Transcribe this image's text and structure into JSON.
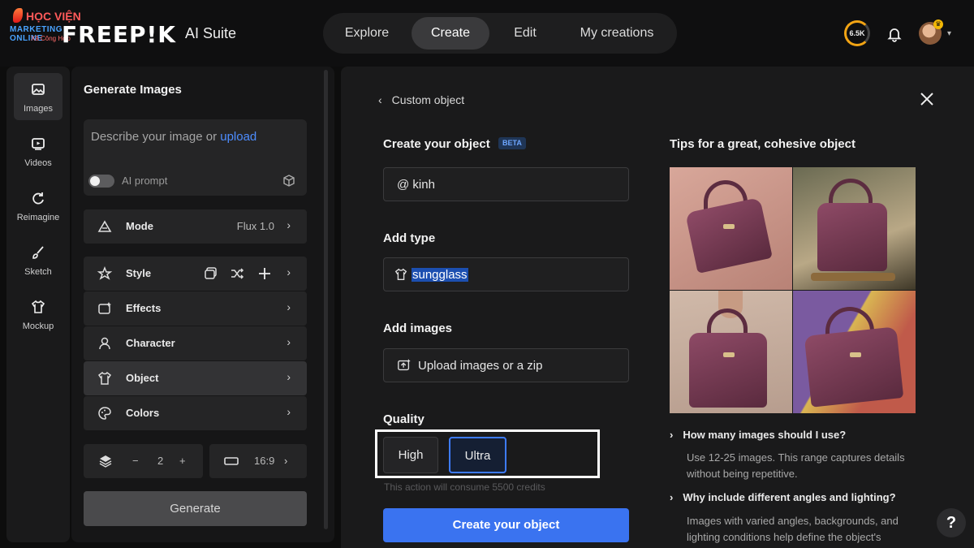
{
  "watermark": {
    "line1": "HỌC VIỆN",
    "line2": "MARKETING ONLINE",
    "line3": "Xã Công Hợp"
  },
  "header": {
    "logo": "FREEP!K",
    "suite": "AI Suite",
    "tabs": [
      {
        "label": "Explore",
        "active": false
      },
      {
        "label": "Create",
        "active": true
      },
      {
        "label": "Edit",
        "active": false
      },
      {
        "label": "My creations",
        "active": false
      }
    ],
    "credits": "6.5K"
  },
  "rail": {
    "items": [
      {
        "label": "Images",
        "icon": "image-icon",
        "active": true
      },
      {
        "label": "Videos",
        "icon": "video-icon",
        "active": false
      },
      {
        "label": "Reimagine",
        "icon": "refresh-icon",
        "active": false
      },
      {
        "label": "Sketch",
        "icon": "brush-icon",
        "active": false
      },
      {
        "label": "Mockup",
        "icon": "shirt-icon",
        "active": false
      }
    ]
  },
  "panel": {
    "title": "Generate Images",
    "prompt_placeholder": "Describe your image or ",
    "prompt_link": "upload",
    "ai_prompt": "AI prompt",
    "rows": [
      {
        "label": "Mode",
        "value": "Flux 1.0",
        "icon": "mode-icon"
      },
      {
        "label": "Style",
        "value": "",
        "icon": "style-icon"
      },
      {
        "label": "Effects",
        "value": "",
        "icon": "effects-icon"
      },
      {
        "label": "Character",
        "value": "",
        "icon": "character-icon"
      },
      {
        "label": "Object",
        "value": "",
        "icon": "object-icon"
      },
      {
        "label": "Colors",
        "value": "",
        "icon": "palette-icon"
      }
    ],
    "count": "2",
    "count_minus": "−",
    "count_plus": "+",
    "ratio": "16:9",
    "generate": "Generate"
  },
  "modal": {
    "back_label": "Custom object",
    "create_title": "Create your object",
    "beta": "BETA",
    "name_value": "@ kinh",
    "type_title": "Add type",
    "type_value": "sungglass",
    "images_title": "Add images",
    "upload_label": "Upload images or a zip",
    "quality_title": "Quality",
    "quality_options": [
      "High",
      "Ultra"
    ],
    "quality_selected": "Ultra",
    "consume_text": "This action will consume 5500 credits",
    "create_button": "Create your object",
    "tips_title": "Tips for a great, cohesive object",
    "faq": [
      {
        "q": "How many images should I use?",
        "a": "Use 12-25 images. This range captures details without being repetitive."
      },
      {
        "q": "Why include different angles and lighting?",
        "a": "Images with varied angles, backgrounds, and lighting conditions help define the object's"
      }
    ]
  },
  "help": "?"
}
